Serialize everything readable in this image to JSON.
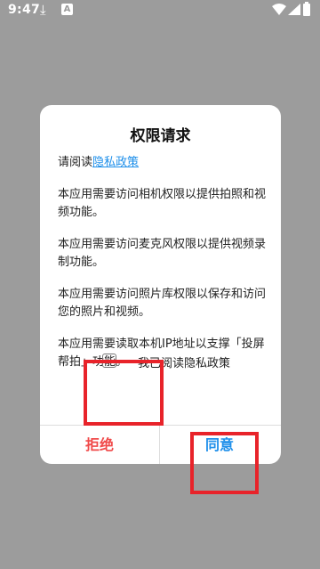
{
  "status_bar": {
    "time": "9:47",
    "download_icon": "download-icon",
    "notification_icon": "A"
  },
  "dialog": {
    "title": "权限请求",
    "intro_prefix": "请阅读",
    "privacy_link": "隐私政策",
    "paragraphs": [
      "本应用需要访问相机权限以提供拍照和视频功能。",
      "本应用需要访问麦克风权限以提供视频录制功能。",
      "本应用需要访问照片库权限以保存和访问您的照片和视频。",
      "本应用需要读取本机IP地址以支撑「投屏帮拍」功能。"
    ],
    "checkbox_label": "我已阅读隐私政策",
    "reject_label": "拒绝",
    "agree_label": "同意"
  },
  "colors": {
    "accent": "#1e8fea",
    "reject": "#f04a4a",
    "annotation": "#e8232a",
    "overlay": "#9c9c9c"
  }
}
